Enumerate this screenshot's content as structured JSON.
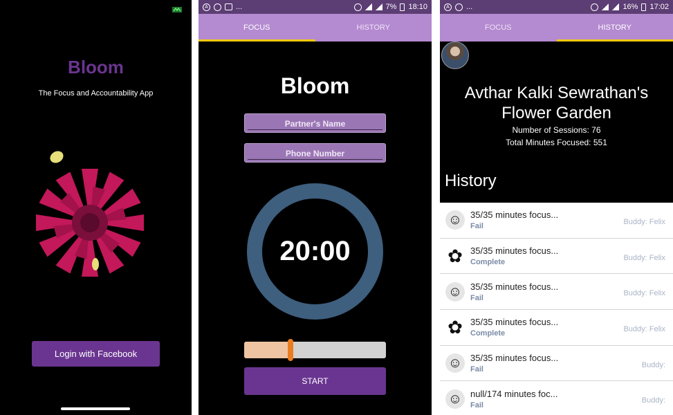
{
  "login_screen": {
    "title": "Bloom",
    "subtitle": "The Focus and Accountability App",
    "login_button": "Login with Facebook"
  },
  "focus_screen": {
    "status_time": "18:10",
    "status_battery": "7%",
    "status_dots": "...",
    "tabs": [
      {
        "label": "FOCUS",
        "active": true
      },
      {
        "label": "HISTORY",
        "active": false
      }
    ],
    "title": "Bloom",
    "partner_placeholder": "Partner's Name",
    "phone_placeholder": "Phone Number",
    "timer": "20:00",
    "slider_fraction": 0.32,
    "start_button": "START"
  },
  "history_screen": {
    "status_time": "17:02",
    "status_battery": "16%",
    "status_dots": "...",
    "tabs": [
      {
        "label": "FOCUS",
        "active": false
      },
      {
        "label": "HISTORY",
        "active": true
      }
    ],
    "garden_title": "Avthar Kalki Sewrathan's Flower Garden",
    "sessions": "Number of Sessions: 76",
    "minutes": "Total Minutes Focused: 551",
    "history_heading": "History",
    "rows": [
      {
        "title": "35/35 minutes focus...",
        "status": "Fail",
        "buddy": "Buddy: Felix",
        "icon": "person-icon"
      },
      {
        "title": "35/35 minutes focus...",
        "status": "Complete",
        "buddy": "Buddy: Felix",
        "icon": "flower-icon"
      },
      {
        "title": "35/35 minutes focus...",
        "status": "Fail",
        "buddy": "Buddy: Felix",
        "icon": "person-icon"
      },
      {
        "title": "35/35 minutes focus...",
        "status": "Complete",
        "buddy": "Buddy: Felix",
        "icon": "flower-icon"
      },
      {
        "title": "35/35 minutes focus...",
        "status": "Fail",
        "buddy": "Buddy:",
        "icon": "person-icon"
      },
      {
        "title": "null/174 minutes foc...",
        "status": "Fail",
        "buddy": "Buddy:",
        "icon": "person-icon"
      }
    ]
  },
  "colors": {
    "brand_purple": "#6a3590",
    "tab_purple": "#b48ad0",
    "tab_indicator": "#f2c80f",
    "timer_ring": "#3e5f7e",
    "slider_thumb": "#ea7d1f"
  }
}
